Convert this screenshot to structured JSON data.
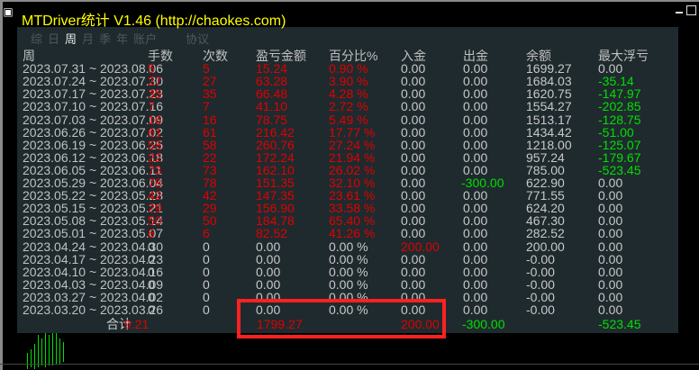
{
  "window": {
    "title": "MTDriver统计 V1.46  (http://chaokes.com)"
  },
  "tabs": [
    {
      "label": "综",
      "active": false
    },
    {
      "label": "日",
      "active": false
    },
    {
      "label": "周",
      "active": true
    },
    {
      "label": "月",
      "active": false
    },
    {
      "label": "季",
      "active": false
    },
    {
      "label": "年",
      "active": false
    },
    {
      "label": "账户",
      "active": false
    },
    {
      "label": "协议",
      "active": false
    }
  ],
  "columns": [
    "周",
    "手数",
    "次数",
    "盈亏金额",
    "百分比%",
    "入金",
    "出金",
    "余额",
    "最大浮亏"
  ],
  "rows": [
    {
      "week": "2023.07.31 ~ 2023.08.06",
      "lots": "5",
      "count": "5",
      "pnl": "15.24",
      "pct": "0.90 %",
      "dep": "0.00",
      "wd": "0.00",
      "bal": "1699.27",
      "dd": "0.00",
      "dd_neg": false,
      "wd_color": "white",
      "dep_color": "white",
      "num_color": "red"
    },
    {
      "week": "2023.07.24 ~ 2023.07.30",
      "lots": "27",
      "count": "27",
      "pnl": "63.28",
      "pct": "3.90 %",
      "dep": "0.00",
      "wd": "0.00",
      "bal": "1684.03",
      "dd": "-35.14",
      "dd_neg": true,
      "wd_color": "white",
      "dep_color": "white",
      "num_color": "red"
    },
    {
      "week": "2023.07.17 ~ 2023.07.23",
      "lots": "35",
      "count": "35",
      "pnl": "66.48",
      "pct": "4.28 %",
      "dep": "0.00",
      "wd": "0.00",
      "bal": "1620.75",
      "dd": "-147.97",
      "dd_neg": true,
      "wd_color": "white",
      "dep_color": "white",
      "num_color": "red"
    },
    {
      "week": "2023.07.10 ~ 2023.07.16",
      "lots": "7",
      "count": "7",
      "pnl": "41.10",
      "pct": "2.72 %",
      "dep": "0.00",
      "wd": "0.00",
      "bal": "1554.27",
      "dd": "-202.85",
      "dd_neg": true,
      "wd_color": "white",
      "dep_color": "white",
      "num_color": "red"
    },
    {
      "week": "2023.07.03 ~ 2023.07.09",
      "lots": "16",
      "count": "16",
      "pnl": "78.75",
      "pct": "5.49 %",
      "dep": "0.00",
      "wd": "0.00",
      "bal": "1513.17",
      "dd": "-128.75",
      "dd_neg": true,
      "wd_color": "white",
      "dep_color": "white",
      "num_color": "red"
    },
    {
      "week": "2023.06.26 ~ 2023.07.02",
      "lots": "61",
      "count": "61",
      "pnl": "216.42",
      "pct": "17.77 %",
      "dep": "0.00",
      "wd": "0.00",
      "bal": "1434.42",
      "dd": "-51.00",
      "dd_neg": true,
      "wd_color": "white",
      "dep_color": "white",
      "num_color": "red"
    },
    {
      "week": "2023.06.19 ~ 2023.06.25",
      "lots": "58",
      "count": "58",
      "pnl": "260.76",
      "pct": "27.24 %",
      "dep": "0.00",
      "wd": "0.00",
      "bal": "1218.00",
      "dd": "-125.07",
      "dd_neg": true,
      "wd_color": "white",
      "dep_color": "white",
      "num_color": "red"
    },
    {
      "week": "2023.06.12 ~ 2023.06.18",
      "lots": "22",
      "count": "22",
      "pnl": "172.24",
      "pct": "21.94 %",
      "dep": "0.00",
      "wd": "0.00",
      "bal": "957.24",
      "dd": "-179.67",
      "dd_neg": true,
      "wd_color": "white",
      "dep_color": "white",
      "num_color": "red"
    },
    {
      "week": "2023.06.05 ~ 2023.06.11",
      "lots": "73",
      "count": "73",
      "pnl": "162.10",
      "pct": "26.02 %",
      "dep": "0.00",
      "wd": "0.00",
      "bal": "785.00",
      "dd": "-523.45",
      "dd_neg": true,
      "wd_color": "white",
      "dep_color": "white",
      "num_color": "red"
    },
    {
      "week": "2023.05.29 ~ 2023.06.04",
      "lots": "78",
      "count": "78",
      "pnl": "151.35",
      "pct": "32.10 %",
      "dep": "0.00",
      "wd": "-300.00",
      "bal": "622.90",
      "dd": "0.00",
      "dd_neg": false,
      "wd_color": "green",
      "dep_color": "white",
      "num_color": "red"
    },
    {
      "week": "2023.05.22 ~ 2023.05.28",
      "lots": "42",
      "count": "42",
      "pnl": "147.35",
      "pct": "23.61 %",
      "dep": "0.00",
      "wd": "0.00",
      "bal": "771.55",
      "dd": "0.00",
      "dd_neg": false,
      "wd_color": "white",
      "dep_color": "white",
      "num_color": "red"
    },
    {
      "week": "2023.05.15 ~ 2023.05.21",
      "lots": "29",
      "count": "29",
      "pnl": "156.90",
      "pct": "33.58 %",
      "dep": "0.00",
      "wd": "0.00",
      "bal": "624.20",
      "dd": "0.00",
      "dd_neg": false,
      "wd_color": "white",
      "dep_color": "white",
      "num_color": "red"
    },
    {
      "week": "2023.05.08 ~ 2023.05.14",
      "lots": "50",
      "count": "50",
      "pnl": "184.78",
      "pct": "65.40 %",
      "dep": "0.00",
      "wd": "0.00",
      "bal": "467.30",
      "dd": "0.00",
      "dd_neg": false,
      "wd_color": "white",
      "dep_color": "white",
      "num_color": "red"
    },
    {
      "week": "2023.05.01 ~ 2023.05.07",
      "lots": "6",
      "count": "6",
      "pnl": "82.52",
      "pct": "41.26 %",
      "dep": "0.00",
      "wd": "0.00",
      "bal": "282.52",
      "dd": "0.00",
      "dd_neg": false,
      "wd_color": "white",
      "dep_color": "white",
      "num_color": "red"
    },
    {
      "week": "2023.04.24 ~ 2023.04.30",
      "lots": "0",
      "count": "0",
      "pnl": "0.00",
      "pct": "0.00 %",
      "dep": "200.00",
      "wd": "0.00",
      "bal": "200.00",
      "dd": "0.00",
      "dd_neg": false,
      "wd_color": "white",
      "dep_color": "red",
      "num_color": "white"
    },
    {
      "week": "2023.04.17 ~ 2023.04.23",
      "lots": "0",
      "count": "0",
      "pnl": "0.00",
      "pct": "0.00 %",
      "dep": "0.00",
      "wd": "0.00",
      "bal": "-0.00",
      "dd": "0.00",
      "dd_neg": false,
      "wd_color": "white",
      "dep_color": "white",
      "num_color": "white"
    },
    {
      "week": "2023.04.10 ~ 2023.04.16",
      "lots": "0",
      "count": "0",
      "pnl": "0.00",
      "pct": "0.00 %",
      "dep": "0.00",
      "wd": "0.00",
      "bal": "-0.00",
      "dd": "0.00",
      "dd_neg": false,
      "wd_color": "white",
      "dep_color": "white",
      "num_color": "white"
    },
    {
      "week": "2023.04.03 ~ 2023.04.09",
      "lots": "0",
      "count": "0",
      "pnl": "0.00",
      "pct": "0.00 %",
      "dep": "0.00",
      "wd": "0.00",
      "bal": "-0.00",
      "dd": "0.00",
      "dd_neg": false,
      "wd_color": "white",
      "dep_color": "white",
      "num_color": "white"
    },
    {
      "week": "2023.03.27 ~ 2023.04.02",
      "lots": "0",
      "count": "0",
      "pnl": "0.00",
      "pct": "0.00 %",
      "dep": "0.00",
      "wd": "0.00",
      "bal": "-0.00",
      "dd": "0.00",
      "dd_neg": false,
      "wd_color": "white",
      "dep_color": "white",
      "num_color": "white"
    },
    {
      "week": "2023.03.20 ~ 2023.03.26",
      "lots": "0",
      "count": "0",
      "pnl": "0.00",
      "pct": "0.00 %",
      "dep": "0.00",
      "wd": "0.00",
      "bal": "-0.00",
      "dd": "0.00",
      "dd_neg": false,
      "wd_color": "white",
      "dep_color": "white",
      "num_color": "white"
    }
  ],
  "total": {
    "label": "合计",
    "lots": "9.21",
    "count": "",
    "pnl": "1799.27",
    "pct": "",
    "dep": "200.00",
    "wd": "-300.00",
    "bal": "",
    "dd": "-523.45"
  }
}
